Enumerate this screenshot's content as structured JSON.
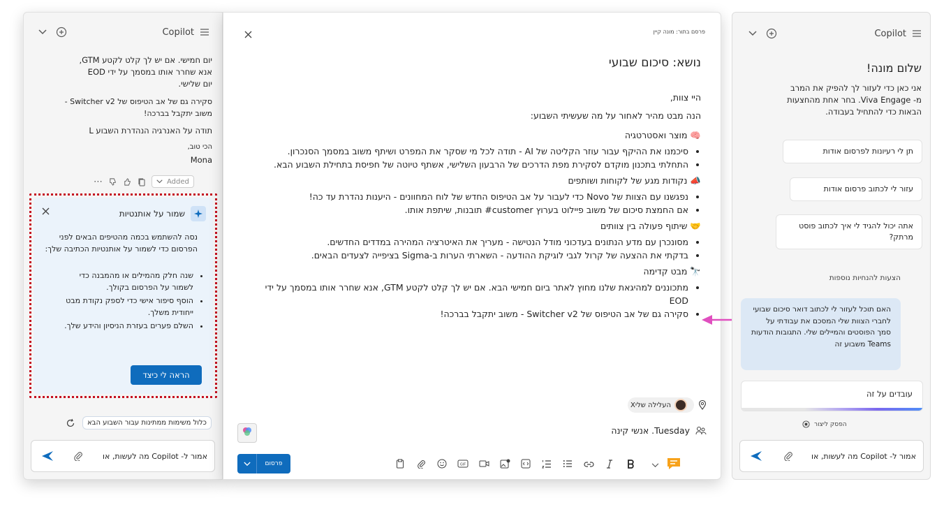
{
  "left_copilot": {
    "title": "Copilot",
    "chat_lines": [
      "יום חמישי. אם יש לך קלט לקטע GTM,",
      "אנא שחרר אותו במסמך על ידי EOD",
      "יום שלישי."
    ],
    "chat_para2_line1": "סקירה גם של אב הטיפוס של Switcher v2 -",
    "chat_para2_line2": "משוב יתקבל בברכה!",
    "chat_para3": "תודה על האנרגיה הנהדרת השבוע L",
    "sign_off": "הכי טוב,",
    "sign_name": "Mona",
    "added_label": "Added",
    "tip_card": {
      "title": "שמור על אותנטיות",
      "intro": "נסה להשתמש בכמה מהטיפים הבאים לפני הפרסום כדי לשמור על אותנטיות הכתיבה שלך:",
      "tips": [
        "שנה חלק מהמילים או מהמבנה כדי לשמור על הפרסום בקולך.",
        "הוסף סיפור אישי כדי לספק נקודת מבט ייחודית משלך.",
        "השלם פערים בעזרת הניסיון והידע שלך."
      ],
      "button": "הראה לי כיצד"
    },
    "suggestion_chip": "כלול משימות ממתינות עבור השבוע הבא",
    "input_placeholder": "אמור ל- Copilot מה לעשות, או"
  },
  "email": {
    "posting_as_label": "פרסם בתור:",
    "posting_as_name": "מונה קיין",
    "subject": "נושא: סיכום שבועי",
    "greeting": "היי צוות,",
    "intro": "הנה מבט מהיר לאחור על מה שעשיתי השבוע:",
    "sections": [
      {
        "title": "מוצר ואסטרטגיה",
        "emoji": "🧠",
        "items": [
          "סיכמנו את ההיקף עבור עוזר הקליטה של AI - תודה לכל מי שסקר את המפרט ושיתף משוב במסמך הסנכרון.",
          "התחלתי בתכנון מוקדם לסקירת מפת הדרכים של הרבעון השלישי, אשתף טיוטה של חפיסת בתחילת השבוע הבא."
        ]
      },
      {
        "title": "נקודות מגע של לקוחות ושותפים",
        "emoji": "📣",
        "items": [
          "נפגשנו עם הצוות של Novo כדי לעבור על אב הטיפוס החדש של לוח המחוונים - היענות נהדרת עד כה!",
          "אם החמצת סיכום של משוב פיילוט בערוץ customer# תובנות, שיתפת אותו."
        ]
      },
      {
        "title": "שיתוף פעולה בין צוותים",
        "emoji": "🤝",
        "items": [
          "מסונכרן עם מדע הנתונים בעדכוני מודל הנטישה - מעריך את האיטרציה המהירה במדדים החדשים.",
          "בדקתי את ההצעה של קרול לגבי לוגיקת ההודעה - השארתי הערות ב-Sigma בציפייה לצעדים הבאים."
        ]
      },
      {
        "title": "מבט קדימה",
        "emoji": "🔭",
        "items": [
          "מתכוננים למהיגאת שלנו מחוץ לאתר ביום חמישי הבא. אם יש לך קלט לקטע GTM, אנא שחרר אותו במסמך על ידי EOD",
          "סקירה גם של אב הטיפוס של Switcher v2 - משוב יתקבל בברכה!"
        ]
      }
    ],
    "community_chip": "העלילה שליX",
    "audience": "Tuesday. אנשי קינה",
    "post_button": "פרסום"
  },
  "right_copilot": {
    "title": "Copilot",
    "greeting": "שלום מונה!",
    "intro": "אני כאן כדי לעזור לך להפיק את המרב מ- Viva Engage. בחר אחת מהחצעות הבאות כדי להתחיל בעבודה.",
    "suggestions": [
      "תן לי רעיונות לפרסום אודות",
      "עזור לי לכתוב פרסום אודות",
      "אתה יכול להגיד לי איך לכתוב פוסט מרתק?"
    ],
    "more_suggestions": "הצעות להנחיות נוספות",
    "user_request": "האם תוכל לעזור לי לכתוב דואר סיכום שבועי לחברי הצוות שלי המסכם את עבודתי על סמך הפוסטים והמיילים שלי. התגובות הודעות Teams משבוע זה",
    "working_status": "עובדים על זה",
    "stop_generating": "הפסק ליצור",
    "input_placeholder": "אמור ל- Copilot מה לעשות, או"
  },
  "colors": {
    "accent": "#0f6cbd",
    "arrow": "#e04fbf",
    "highlight_border": "#c50f1f",
    "bubble": "#dce8f5"
  }
}
